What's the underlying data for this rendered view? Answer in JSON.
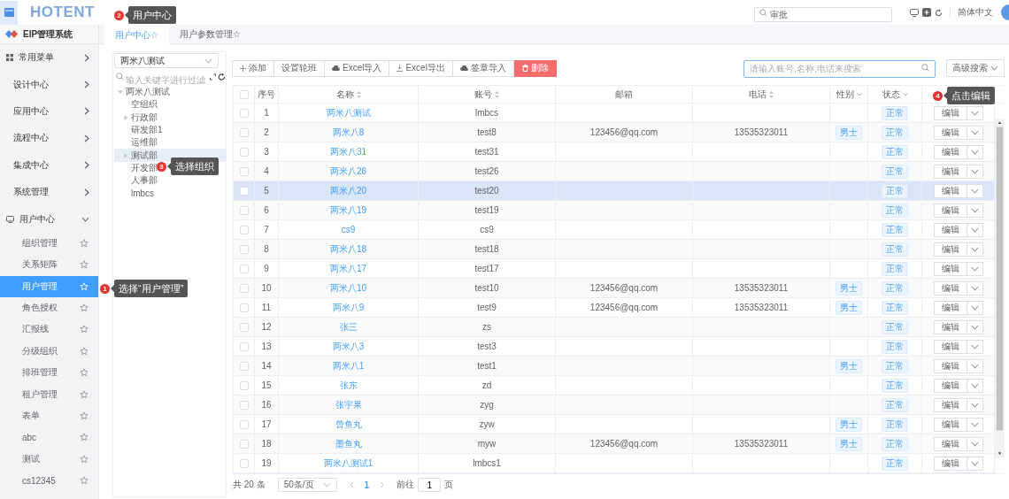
{
  "top_bar": {
    "logo": "HOTENT",
    "search": {
      "value": "审批"
    },
    "language": "简体中文"
  },
  "sidebar": {
    "title": "EIP管理系统",
    "items": [
      {
        "label": "常用菜单",
        "expanded": false
      },
      {
        "label": "设计中心",
        "expanded": false
      },
      {
        "label": "应用中心",
        "expanded": false
      },
      {
        "label": "流程中心",
        "expanded": false
      },
      {
        "label": "集成中心",
        "expanded": false
      },
      {
        "label": "系统管理",
        "expanded": false
      },
      {
        "label": "用户中心",
        "expanded": true,
        "children": [
          {
            "label": "组织管理",
            "selected": false
          },
          {
            "label": "关系矩阵",
            "selected": false
          },
          {
            "label": "用户管理",
            "selected": true
          },
          {
            "label": "角色授权",
            "selected": false
          },
          {
            "label": "汇报线",
            "selected": false
          },
          {
            "label": "分级组织",
            "selected": false
          },
          {
            "label": "排班管理",
            "selected": false
          },
          {
            "label": "租户管理",
            "selected": false
          },
          {
            "label": "表单",
            "selected": false
          },
          {
            "label": "abc",
            "selected": false
          },
          {
            "label": "测试",
            "selected": false
          },
          {
            "label": "cs12345",
            "selected": false
          }
        ]
      }
    ]
  },
  "tabs": [
    {
      "label": "用户中心☆",
      "selected": true
    },
    {
      "label": "用户参数管理☆",
      "selected": false
    }
  ],
  "tree": {
    "select": {
      "value": "两米八测试"
    },
    "filter": {
      "placeholder": "输入关键字进行过滤"
    },
    "nodes": [
      {
        "label": "两米八测试",
        "expanded": true,
        "selected": false,
        "children": [
          {
            "label": "空组织",
            "selected": false
          },
          {
            "label": "行政部",
            "expanded": false,
            "selected": false
          },
          {
            "label": "研发部1",
            "selected": false
          },
          {
            "label": "运维部",
            "selected": false
          },
          {
            "label": "测试部",
            "expanded": false,
            "selected": true
          },
          {
            "label": "开发部",
            "selected": false
          },
          {
            "label": "人事部",
            "selected": false
          },
          {
            "label": "lmbcs",
            "selected": false
          }
        ]
      }
    ]
  },
  "toolbar": {
    "buttons": [
      {
        "label": "添加",
        "kind": "add"
      },
      {
        "label": "设置轮班",
        "kind": "plain"
      },
      {
        "label": "Excel导入",
        "kind": "upload"
      },
      {
        "label": "Excel导出",
        "kind": "download"
      },
      {
        "label": "签章导入",
        "kind": "upload"
      },
      {
        "label": "删除",
        "kind": "delete"
      }
    ],
    "search": {
      "placeholder": "请输入账号,名称,电话来搜索"
    },
    "advanced_search": "高级搜索"
  },
  "table": {
    "select_all": {
      "checked": false
    },
    "columns": [
      {
        "label": "序号",
        "kind": "plain"
      },
      {
        "label": "名称",
        "kind": "sort"
      },
      {
        "label": "账号",
        "kind": "sort"
      },
      {
        "label": "邮箱",
        "kind": "plain"
      },
      {
        "label": "电话",
        "kind": "sort"
      },
      {
        "label": "性别",
        "kind": "filter"
      },
      {
        "label": "状态",
        "kind": "filter"
      }
    ],
    "rows": [
      {
        "index": "1",
        "name": "两米八测试",
        "account": "lmbcs",
        "status": "正常",
        "action": "编辑",
        "checked": false,
        "highlighted": false
      },
      {
        "index": "2",
        "name": "两米八8",
        "account": "test8",
        "email": "123456@qq.com",
        "phone": "13535323011",
        "gender": "男士",
        "status": "正常",
        "action": "编辑",
        "checked": false,
        "highlighted": false
      },
      {
        "index": "3",
        "name": "两米八31",
        "account": "test31",
        "status": "正常",
        "action": "编辑",
        "checked": false,
        "highlighted": false
      },
      {
        "index": "4",
        "name": "两米八26",
        "account": "test26",
        "status": "正常",
        "action": "编辑",
        "checked": false,
        "highlighted": false
      },
      {
        "index": "5",
        "name": "两米八20",
        "account": "test20",
        "status": "正常",
        "action": "编辑",
        "checked": false,
        "highlighted": true
      },
      {
        "index": "6",
        "name": "两米八19",
        "account": "test19",
        "status": "正常",
        "action": "编辑",
        "checked": false,
        "highlighted": false
      },
      {
        "index": "7",
        "name": "cs9",
        "account": "cs9",
        "status": "正常",
        "action": "编辑",
        "checked": false,
        "highlighted": false
      },
      {
        "index": "8",
        "name": "两米八18",
        "account": "test18",
        "status": "正常",
        "action": "编辑",
        "checked": false,
        "highlighted": false
      },
      {
        "index": "9",
        "name": "两米八17",
        "account": "test17",
        "status": "正常",
        "action": "编辑",
        "checked": false,
        "highlighted": false
      },
      {
        "index": "10",
        "name": "两米八10",
        "account": "test10",
        "email": "123456@qq.com",
        "phone": "13535323011",
        "gender": "男士",
        "status": "正常",
        "action": "编辑",
        "checked": false,
        "highlighted": false
      },
      {
        "index": "11",
        "name": "两米八9",
        "account": "test9",
        "email": "123456@qq.com",
        "phone": "13535323011",
        "gender": "男士",
        "status": "正常",
        "action": "编辑",
        "checked": false,
        "highlighted": false
      },
      {
        "index": "12",
        "name": "张三",
        "account": "zs",
        "status": "正常",
        "action": "编辑",
        "checked": false,
        "highlighted": false
      },
      {
        "index": "13",
        "name": "两米八3",
        "account": "test3",
        "status": "正常",
        "action": "编辑",
        "checked": false,
        "highlighted": false
      },
      {
        "index": "14",
        "name": "两米八1",
        "account": "test1",
        "gender": "男士",
        "status": "正常",
        "action": "编辑",
        "checked": false,
        "highlighted": false
      },
      {
        "index": "15",
        "name": "张东",
        "account": "zd",
        "status": "正常",
        "action": "编辑",
        "checked": false,
        "highlighted": false
      },
      {
        "index": "16",
        "name": "张宇果",
        "account": "zyg",
        "status": "正常",
        "action": "编辑",
        "checked": false,
        "highlighted": false
      },
      {
        "index": "17",
        "name": "曾鱼丸",
        "account": "zyw",
        "gender": "男士",
        "status": "正常",
        "action": "编辑",
        "checked": false,
        "highlighted": false
      },
      {
        "index": "18",
        "name": "墨鱼丸",
        "account": "myw",
        "email": "123456@qq.com",
        "phone": "13535323011",
        "gender": "男士",
        "status": "正常",
        "action": "编辑",
        "checked": false,
        "highlighted": false
      },
      {
        "index": "19",
        "name": "两米八测试1",
        "account": "lmbcs1",
        "status": "正常",
        "action": "编辑",
        "checked": false,
        "highlighted": false
      }
    ]
  },
  "pagination": {
    "total": "共 20 条",
    "page_size": "50条/页",
    "pages": [
      {
        "label": "1",
        "selected": true
      }
    ],
    "goto_label": "前往",
    "goto_value": "1",
    "goto_suffix": "页"
  },
  "annotations": [
    {
      "number": "2",
      "text": "用户中心"
    },
    {
      "number": "4",
      "text": "点击编辑"
    },
    {
      "number": "3",
      "text": "选择组织"
    },
    {
      "number": "1",
      "text": "选择“用户管理”"
    }
  ]
}
